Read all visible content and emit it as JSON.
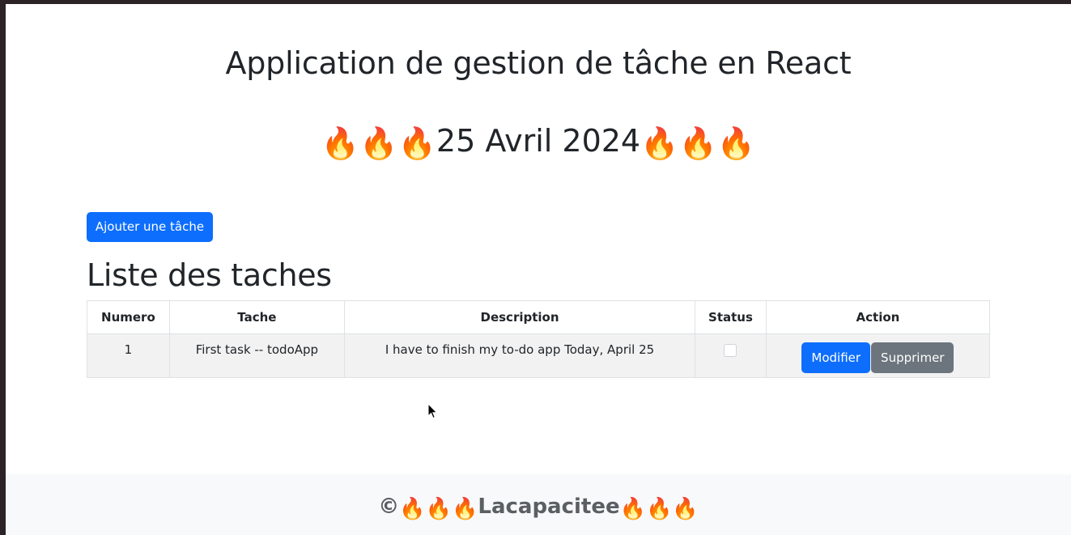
{
  "header": {
    "title": "Application de gestion de tâche en React",
    "date_text": "25 Avril 2024",
    "flame_glyph": "🔥"
  },
  "toolbar": {
    "add_task_label": "Ajouter une tâche"
  },
  "list": {
    "title": "Liste des taches",
    "columns": [
      "Numero",
      "Tache",
      "Description",
      "Status",
      "Action"
    ],
    "rows": [
      {
        "number": "1",
        "task": "First task -- todoApp",
        "description": "I have to finish my to-do app Today, April 25",
        "status_checked": false,
        "edit_label": "Modifier",
        "delete_label": "Supprimer"
      }
    ]
  },
  "footer": {
    "copyright_symbol": "©",
    "brand": "Lacapacitee"
  },
  "colors": {
    "primary": "#0d6efd",
    "secondary": "#6c757d",
    "footer_bg": "#f8f9fa",
    "row_stripe": "#f2f2f2"
  }
}
